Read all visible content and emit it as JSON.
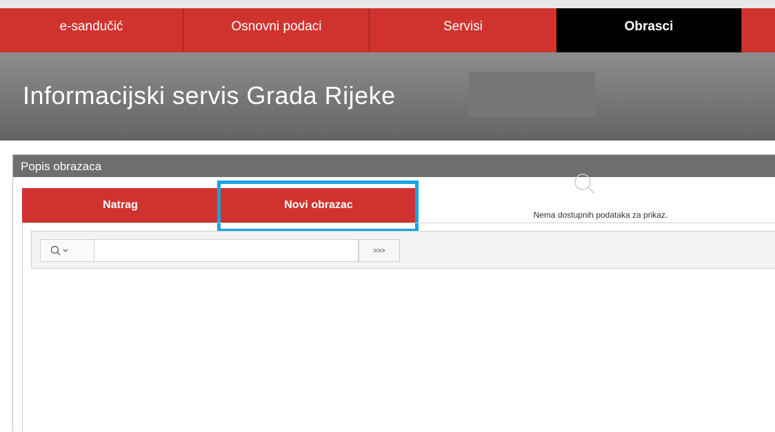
{
  "nav": {
    "items": [
      {
        "label": "e-sandučić"
      },
      {
        "label": "Osnovni podaci"
      },
      {
        "label": "Servisi"
      },
      {
        "label": "Obrasci"
      }
    ],
    "active": "Obrasci"
  },
  "banner": {
    "title": "Informacijski servis Grada Rijeke"
  },
  "panel": {
    "title": "Popis obrazaca",
    "back_label": "Natrag",
    "new_label": "Novi obrazac",
    "search": {
      "value": "",
      "go_label": ">>>"
    },
    "empty_message": "Nema dostupnih podataka za prikaz."
  },
  "colors": {
    "brand_red": "#d0332e",
    "active_tab": "#000000",
    "highlight": "#17a3e6"
  }
}
